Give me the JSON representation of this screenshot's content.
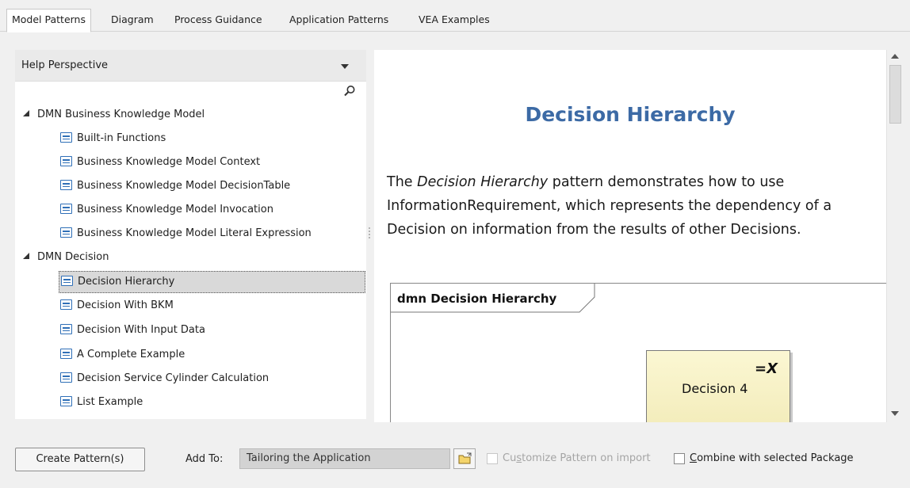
{
  "tabs": [
    {
      "label": "Model Patterns",
      "active": true
    },
    {
      "label": "Diagram",
      "active": false
    },
    {
      "label": "Process Guidance",
      "active": false
    },
    {
      "label": "Application Patterns",
      "active": false
    },
    {
      "label": "VEA Examples",
      "active": false
    }
  ],
  "perspective": {
    "label": "Help Perspective"
  },
  "tree": {
    "group1": "DMN Business Knowledge Model",
    "group1_items": [
      "Built-in Functions",
      "Business Knowledge Model Context",
      "Business Knowledge Model DecisionTable",
      "Business Knowledge Model Invocation",
      "Business Knowledge Model Literal Expression"
    ],
    "group2": "DMN Decision",
    "group2_items": [
      "Decision Hierarchy",
      "Decision With BKM",
      "Decision With Input Data",
      "A Complete Example",
      "Decision Service Cylinder Calculation",
      "List Example"
    ],
    "selected": "Decision Hierarchy"
  },
  "doc": {
    "title": "Decision Hierarchy",
    "text_prefix": "The ",
    "text_italic": "Decision Hierarchy",
    "text_rest": " pattern demonstrates how to use InformationRequirement, which represents the dependency of a Decision on information from the results of other Decisions.",
    "diagram_label": "dmn Decision Hierarchy",
    "decision_label": "Decision 4",
    "decision_mark": "=X"
  },
  "bottom": {
    "create_button": "Create Pattern(s)",
    "add_to_label": "Add To:",
    "add_to_value": "Tailoring the Application",
    "customize_prefix": "Cu",
    "customize_underline": "s",
    "customize_rest": "tomize Pattern on import",
    "combine_underline": "C",
    "combine_rest": "ombine with selected Package"
  },
  "colors": {
    "title_blue": "#3c6aa5",
    "icon_blue": "#2f6fb7",
    "decision_fill": "#f8f3c8"
  }
}
